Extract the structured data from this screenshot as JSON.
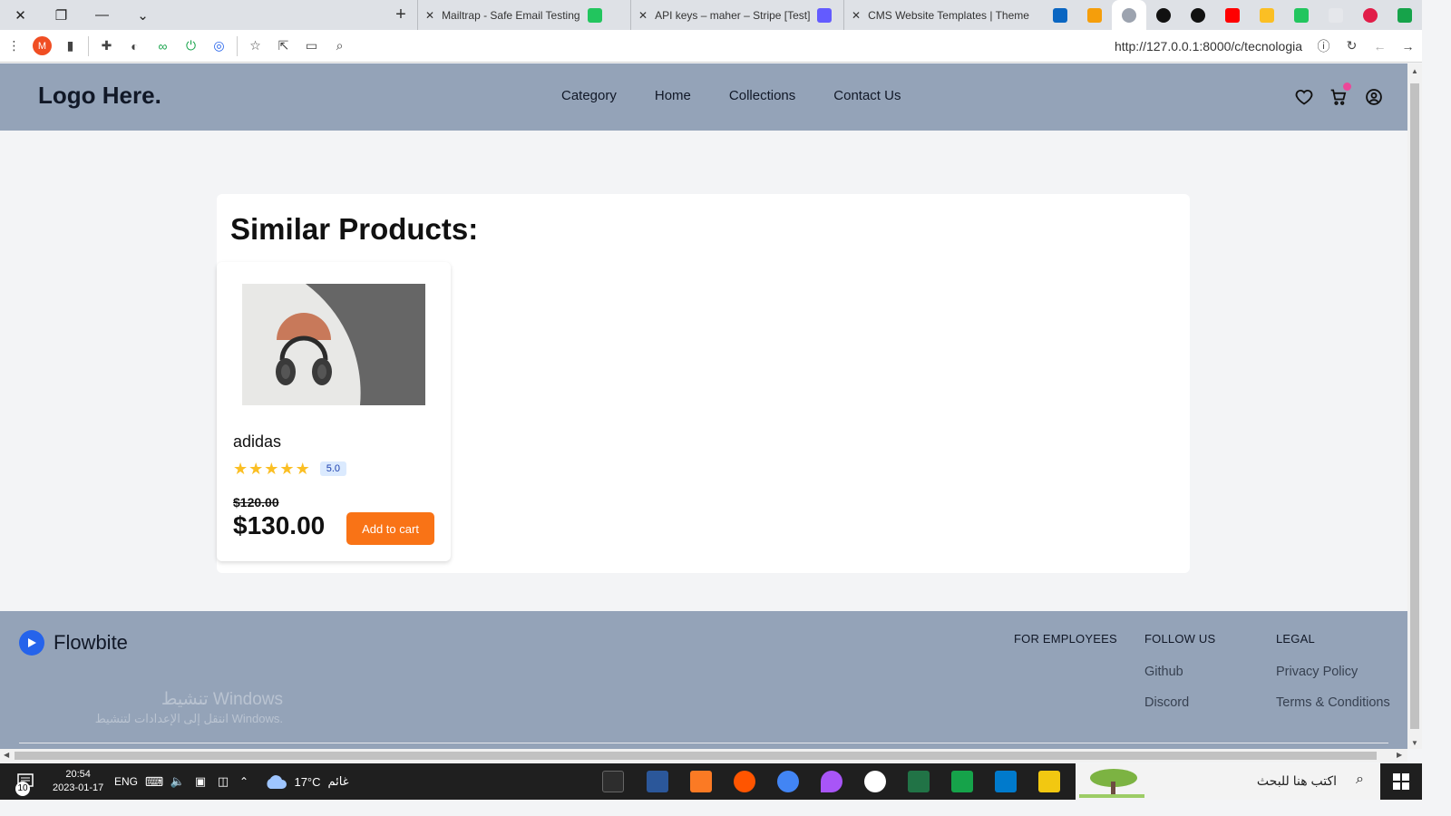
{
  "browser": {
    "tabs": [
      {
        "title": "Mailtrap - Safe Email Testing",
        "favicon_color": "#22c55e"
      },
      {
        "title": "API keys – maher – Stripe [Test]",
        "favicon_color": "#635bff"
      },
      {
        "title": "CMS Website Templates | Theme",
        "favicon_color": "#111111"
      }
    ],
    "pinned_tabs": [
      "#0a66c2",
      "#f59e0b",
      "#ffffff",
      "#111111",
      "#111111",
      "#ff0000",
      "#fbbf24",
      "#22c55e",
      "#e5e7eb",
      "#e11d48",
      "#16a34a"
    ],
    "profile_initial": "M",
    "url": "http://127.0.0.1:8000/c/tecnologia"
  },
  "header": {
    "logo": "Logo Here.",
    "nav": [
      "Category",
      "Home",
      "Collections",
      "Contact Us"
    ]
  },
  "section": {
    "title": "Similar Products:"
  },
  "product": {
    "name": "adidas",
    "rating": 5,
    "rating_label": "5.0",
    "old_price": "$120.00",
    "price": "$130.00",
    "button": "Add to cart"
  },
  "footer": {
    "brand": "Flowbite",
    "columns": [
      {
        "heading": "FOR EMPLOYEES",
        "links": []
      },
      {
        "heading": "FOLLOW US",
        "links": [
          "Github",
          "Discord"
        ]
      },
      {
        "heading": "LEGAL",
        "links": [
          "Privacy Policy",
          "Terms & Conditions"
        ]
      }
    ],
    "watermark_line1": "تنشيط Windows",
    "watermark_line2": "انتقل إلى الإعدادات لتنشيط Windows."
  },
  "taskbar": {
    "time": "20:54",
    "date": "2023-01-17",
    "language": "ENG",
    "weather_temp": "17°C",
    "weather_text": "غائم",
    "notification_count": "10",
    "search_placeholder": "اكتب هنا للبحث",
    "apps": [
      "#2d2d2d",
      "#2b579a",
      "#fb7a24",
      "#ff5500",
      "#4285f4",
      "#a855f7",
      "#ffffff",
      "#217346",
      "#16a34a",
      "#007acc",
      "#f2c811"
    ]
  }
}
